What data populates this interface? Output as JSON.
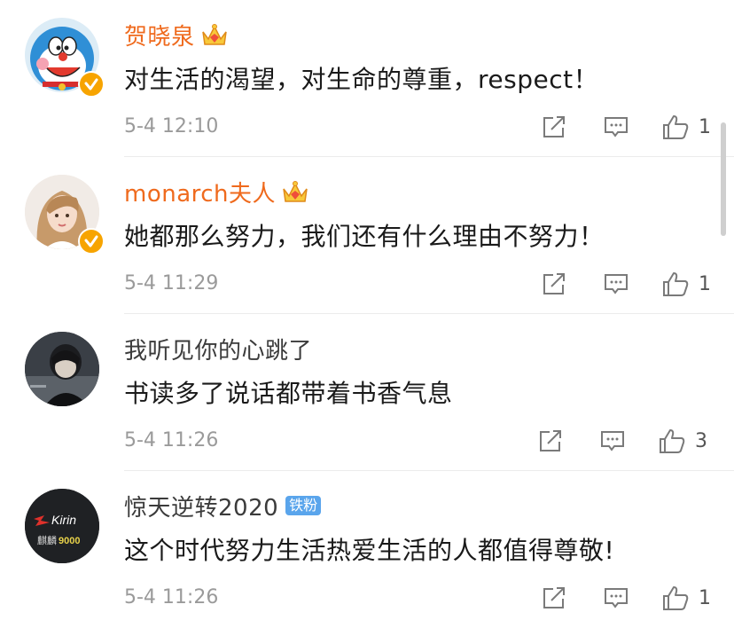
{
  "comments": [
    {
      "username": "贺晓泉",
      "text": "对生活的渴望，对生命的尊重，respect！",
      "time": "5-4 12:10",
      "likes": "1",
      "verified": true,
      "vip_crown": true,
      "fan_badge": "",
      "name_color": "#ef6a1d"
    },
    {
      "username": "monarch夫人",
      "text": "她都那么努力，我们还有什么理由不努力！",
      "time": "5-4 11:29",
      "likes": "1",
      "verified": true,
      "vip_crown": true,
      "fan_badge": "",
      "name_color": "#ef6a1d"
    },
    {
      "username": "我听见你的心跳了",
      "text": "书读多了说话都带着书香气息",
      "time": "5-4 11:26",
      "likes": "3",
      "verified": false,
      "vip_crown": false,
      "fan_badge": "",
      "name_color": "#3b3b3b"
    },
    {
      "username": "惊天逆转2020",
      "text": "这个时代努力生活热爱生活的人都值得尊敬!",
      "time": "5-4 11:26",
      "likes": "1",
      "verified": false,
      "vip_crown": false,
      "fan_badge": "铁粉",
      "name_color": "#3b3b3b"
    }
  ],
  "avatar4": {
    "brand": "Kirin",
    "caption_cn": "麒麟",
    "caption_num": "9000"
  },
  "icons": [
    "share-icon",
    "comment-icon",
    "thumbs-up-icon",
    "verified-badge-icon",
    "crown-icon"
  ],
  "colors": {
    "vip_name": "#ef6a1d",
    "verified_badge": "#f7a400",
    "fan_badge": "#5aa5ec",
    "icon_gray": "#7a7a7a"
  }
}
